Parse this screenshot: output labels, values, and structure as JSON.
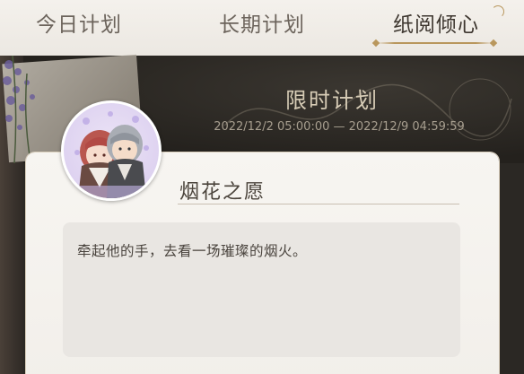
{
  "tabs": [
    {
      "label": "今日计划",
      "active": false
    },
    {
      "label": "长期计划",
      "active": false
    },
    {
      "label": "纸阅倾心",
      "active": true
    }
  ],
  "banner": {
    "title": "限时计划",
    "time_range": "2022/12/2 05:00:00 — 2022/12/9 04:59:59"
  },
  "plan": {
    "name": "烟花之愿",
    "description": "牵起他的手，去看一场璀璨的烟火。"
  },
  "colors": {
    "accent_gold": "#b9975d",
    "tab_active_text": "#3d362f",
    "banner_bg": "#24211d",
    "card_bg": "#f7f5f1"
  }
}
